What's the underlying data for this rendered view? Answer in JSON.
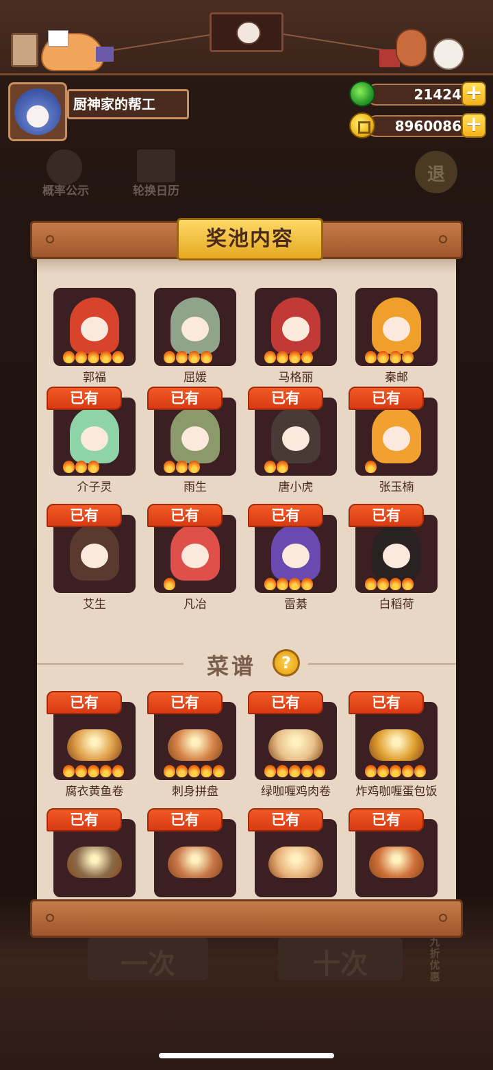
{
  "header": {
    "player_name": "厨神家的帮工",
    "jade_amount": "21424",
    "coin_amount": "8960086"
  },
  "background_menu": {
    "probability": "概率公示",
    "calendar": "轮换日历",
    "back": "退",
    "single_draw": "一次",
    "ten_draw": "十次",
    "discount": "九折优惠"
  },
  "panel": {
    "title": "奖池内容",
    "owned_label": "已有",
    "characters": [
      {
        "name": "郭福",
        "stars": 5
      },
      {
        "name": "屈媛",
        "stars": 4
      },
      {
        "name": "马格丽",
        "stars": 4
      },
      {
        "name": "秦邮",
        "stars": 4
      },
      {
        "name": "介子灵",
        "stars": 3
      },
      {
        "name": "雨生",
        "stars": 3
      },
      {
        "name": "唐小虎",
        "stars": 2
      },
      {
        "name": "张玉楠",
        "stars": 1
      },
      {
        "name": "艾生",
        "stars": 0
      },
      {
        "name": "凡冶",
        "stars": 1
      },
      {
        "name": "雷綦",
        "stars": 4
      },
      {
        "name": "白稻荷",
        "stars": 4
      }
    ],
    "recipes_title": "菜谱",
    "help_icon": "?",
    "recipes": [
      {
        "name": "腐衣黄鱼卷",
        "stars": 5
      },
      {
        "name": "刺身拼盘",
        "stars": 5
      },
      {
        "name": "绿咖喱鸡肉卷",
        "stars": 5
      },
      {
        "name": "炸鸡咖喱蛋包饭",
        "stars": 5
      },
      {
        "name": "",
        "stars": 0
      },
      {
        "name": "",
        "stars": 0
      },
      {
        "name": "",
        "stars": 0
      },
      {
        "name": "",
        "stars": 0
      }
    ]
  },
  "colors": {
    "tag_red": "#e8461a",
    "paper": "#e8d7c5",
    "card_bg": "#3b1f22",
    "wood": "#b36b3c",
    "gold_plate": "#f0c140"
  }
}
